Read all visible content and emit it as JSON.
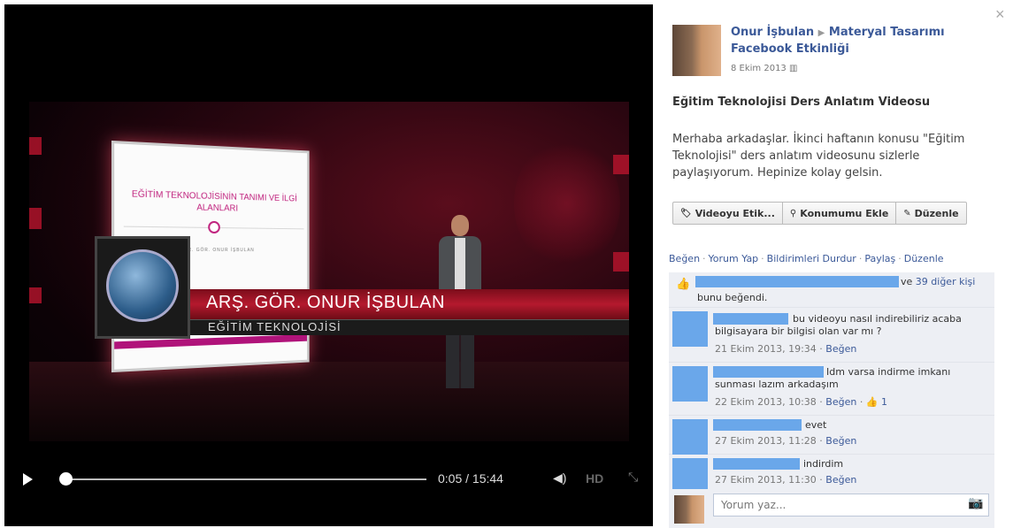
{
  "video": {
    "slide": {
      "title": "EĞİTİM TEKNOLOJİSİNİN TANIMI VE İLGİ ALANLARI",
      "author": "GÖR. GÖR. ONUR İŞBULAN"
    },
    "lower_third": {
      "name": "ARŞ. GÖR. ONUR İŞBULAN",
      "department": "EĞİTİM TEKNOLOJİSİ"
    },
    "controls": {
      "play_icon": "play-icon",
      "time": "0:05 / 15:44",
      "progress_fraction": 0.005,
      "volume_icon": "volume-icon",
      "volume_glyph": "◀)",
      "hd_label": "HD",
      "expand_icon": "expand-icon",
      "expand_glyph": "⤡"
    }
  },
  "close_glyph": "×",
  "sidebar": {
    "author": "Onur İşbulan",
    "arrow": "▶",
    "target": "Materyal Tasarımı Facebook Etkinliği",
    "date": "8 Ekim 2013",
    "date_icon": "▥",
    "post_title": "Eğitim Teknolojisi Ders Anlatım Videosu",
    "post_body": "Merhaba arkadaşlar. İkinci haftanın konusu \"Eğitim Teknolojisi\" ders anlatım videosunu sizlerle paylaşıyorum. Hepinize kolay gelsin.",
    "buttons": [
      {
        "label": "Videoyu Etik...",
        "icon": "tag-icon",
        "glyph": "🏷"
      },
      {
        "label": "Konumumu Ekle",
        "icon": "location-pin-icon",
        "glyph": "⚲"
      },
      {
        "label": "Düzenle",
        "icon": "pencil-icon",
        "glyph": "✎"
      }
    ],
    "actions": [
      "Beğen",
      "Yorum Yap",
      "Bildirimleri Durdur",
      "Paylaş",
      "Düzenle"
    ],
    "action_separator": "·",
    "likes": {
      "icon_glyph": "👍",
      "tail_prefix": "ve",
      "others_link": "39 diğer kişi",
      "line2": "bunu beğendi."
    },
    "comments": [
      {
        "text": "bu videoyu nasıl indirebiliriz acaba bilgisayara bir bilgisi olan var mı ?",
        "date": "21 Ekim 2013, 19:34",
        "like": "Beğen",
        "like_count": ""
      },
      {
        "text": "Idm varsa indirme imkanı sunması lazım arkadaşım",
        "date": "22 Ekim 2013, 10:38",
        "like": "Beğen",
        "like_count": "1"
      },
      {
        "text": "evet",
        "date": "27 Ekim 2013, 11:28",
        "like": "Beğen",
        "like_count": ""
      },
      {
        "text": "indirdim",
        "date": "27 Ekim 2013, 11:30",
        "like": "Beğen",
        "like_count": ""
      }
    ],
    "comment_placeholder": "Yorum yaz...",
    "camera_glyph": "📷"
  }
}
